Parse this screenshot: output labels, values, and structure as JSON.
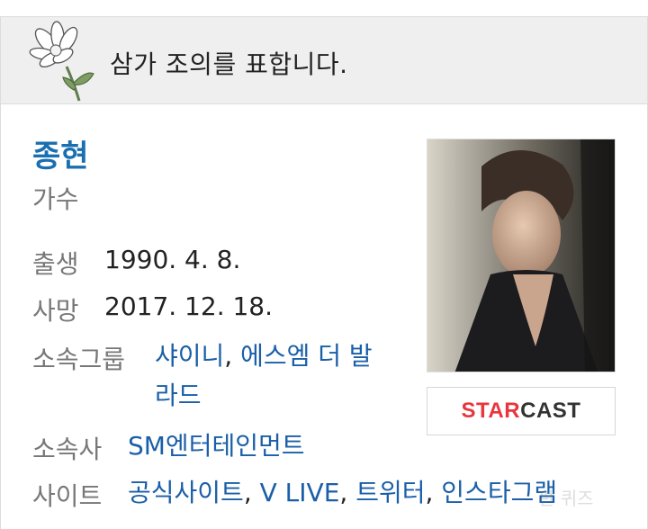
{
  "condolence": {
    "text": "삼가 조의를 표합니다."
  },
  "person": {
    "name": "종현",
    "occupation": "가수"
  },
  "info": {
    "birth": {
      "label": "출생",
      "value": "1990. 4. 8."
    },
    "death": {
      "label": "사망",
      "value": "2017. 12. 18."
    },
    "group": {
      "label": "소속그룹",
      "links": [
        "샤이니",
        "에스엠 더 발",
        "라드"
      ],
      "separator": ","
    },
    "agency": {
      "label": "소속사",
      "value": "SM엔터테인먼트"
    },
    "sites": {
      "label": "사이트",
      "links": [
        "공식사이트",
        "V LIVE",
        "트위터",
        "인스타그램"
      ],
      "separator": ","
    }
  },
  "badge": {
    "star": "STAR",
    "cast": "CAST"
  },
  "watermark": {
    "text": "판 퀴즈"
  },
  "icons": {
    "flower": "chrysanthemum-icon"
  },
  "colors": {
    "link": "#1a5fa8",
    "name": "#1a6fb0",
    "label": "#777777",
    "bar": "#efefef",
    "star_red": "#e8363f"
  }
}
